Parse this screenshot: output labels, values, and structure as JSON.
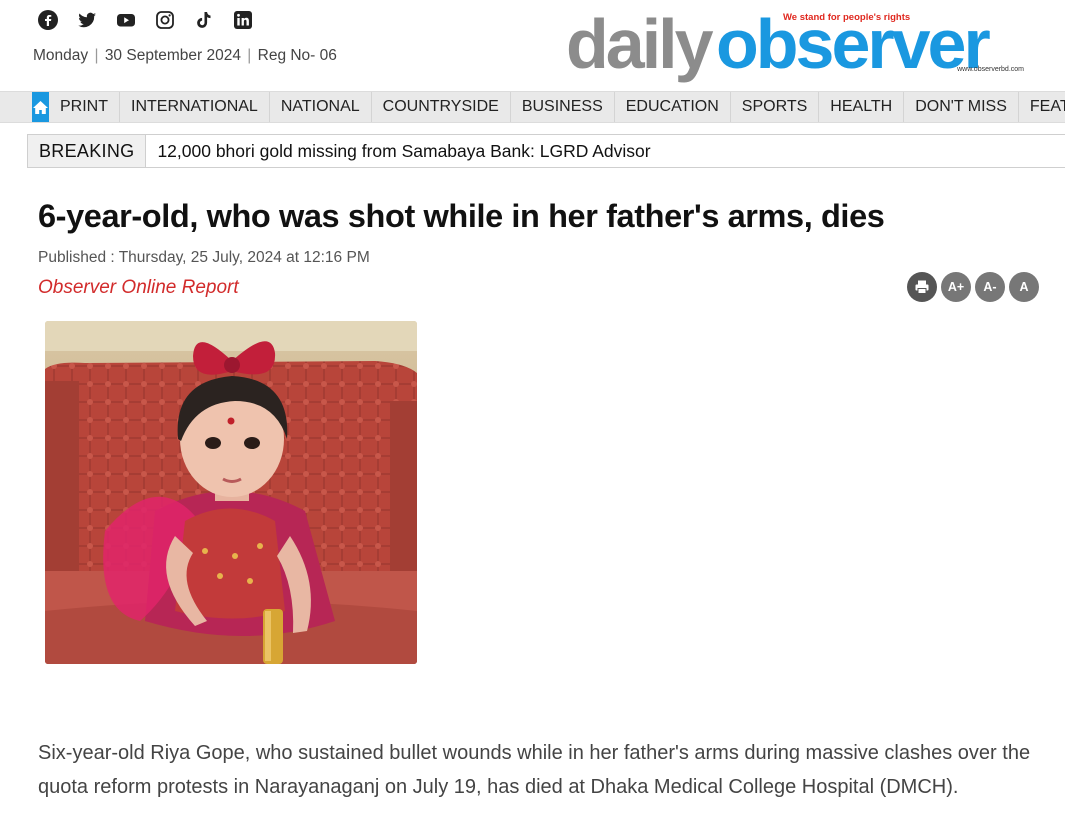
{
  "social": {
    "icons": [
      "facebook-icon",
      "twitter-icon",
      "youtube-icon",
      "instagram-icon",
      "tiktok-icon",
      "linkedin-icon"
    ]
  },
  "header": {
    "day": "Monday",
    "date": "30 September 2024",
    "reg": "Reg No- 06",
    "logo_part1": "daily",
    "logo_part2": "observer",
    "tagline": "We stand for people's rights",
    "logo_url": "www.observerbd.com"
  },
  "nav": {
    "items": [
      "PRINT",
      "INTERNATIONAL",
      "NATIONAL",
      "COUNTRYSIDE",
      "BUSINESS",
      "EDUCATION",
      "SPORTS",
      "HEALTH",
      "DON'T MISS",
      "FEATURE"
    ]
  },
  "breaking": {
    "label": "BREAKING",
    "text": "12,000 bhori gold missing from Samabaya Bank: LGRD Advisor"
  },
  "article": {
    "headline": "6-year-old, who was shot while in her father's arms, dies",
    "published": "Published : Thursday, 25 July, 2024 at 12:16 PM",
    "byline": "Observer Online Report",
    "body": "Six-year-old Riya Gope, who sustained bullet wounds while in her father's arms during massive clashes over the quota reform protests in Narayanaganj on July 19, has died at Dhaka Medical College Hospital (DMCH)."
  },
  "tools": {
    "font_increase": "A+",
    "font_decrease": "A-",
    "font_reset": "A"
  },
  "colors": {
    "brand_blue": "#1a98e0",
    "brand_gray": "#8c8c8c",
    "byline_red": "#d22b2b"
  }
}
